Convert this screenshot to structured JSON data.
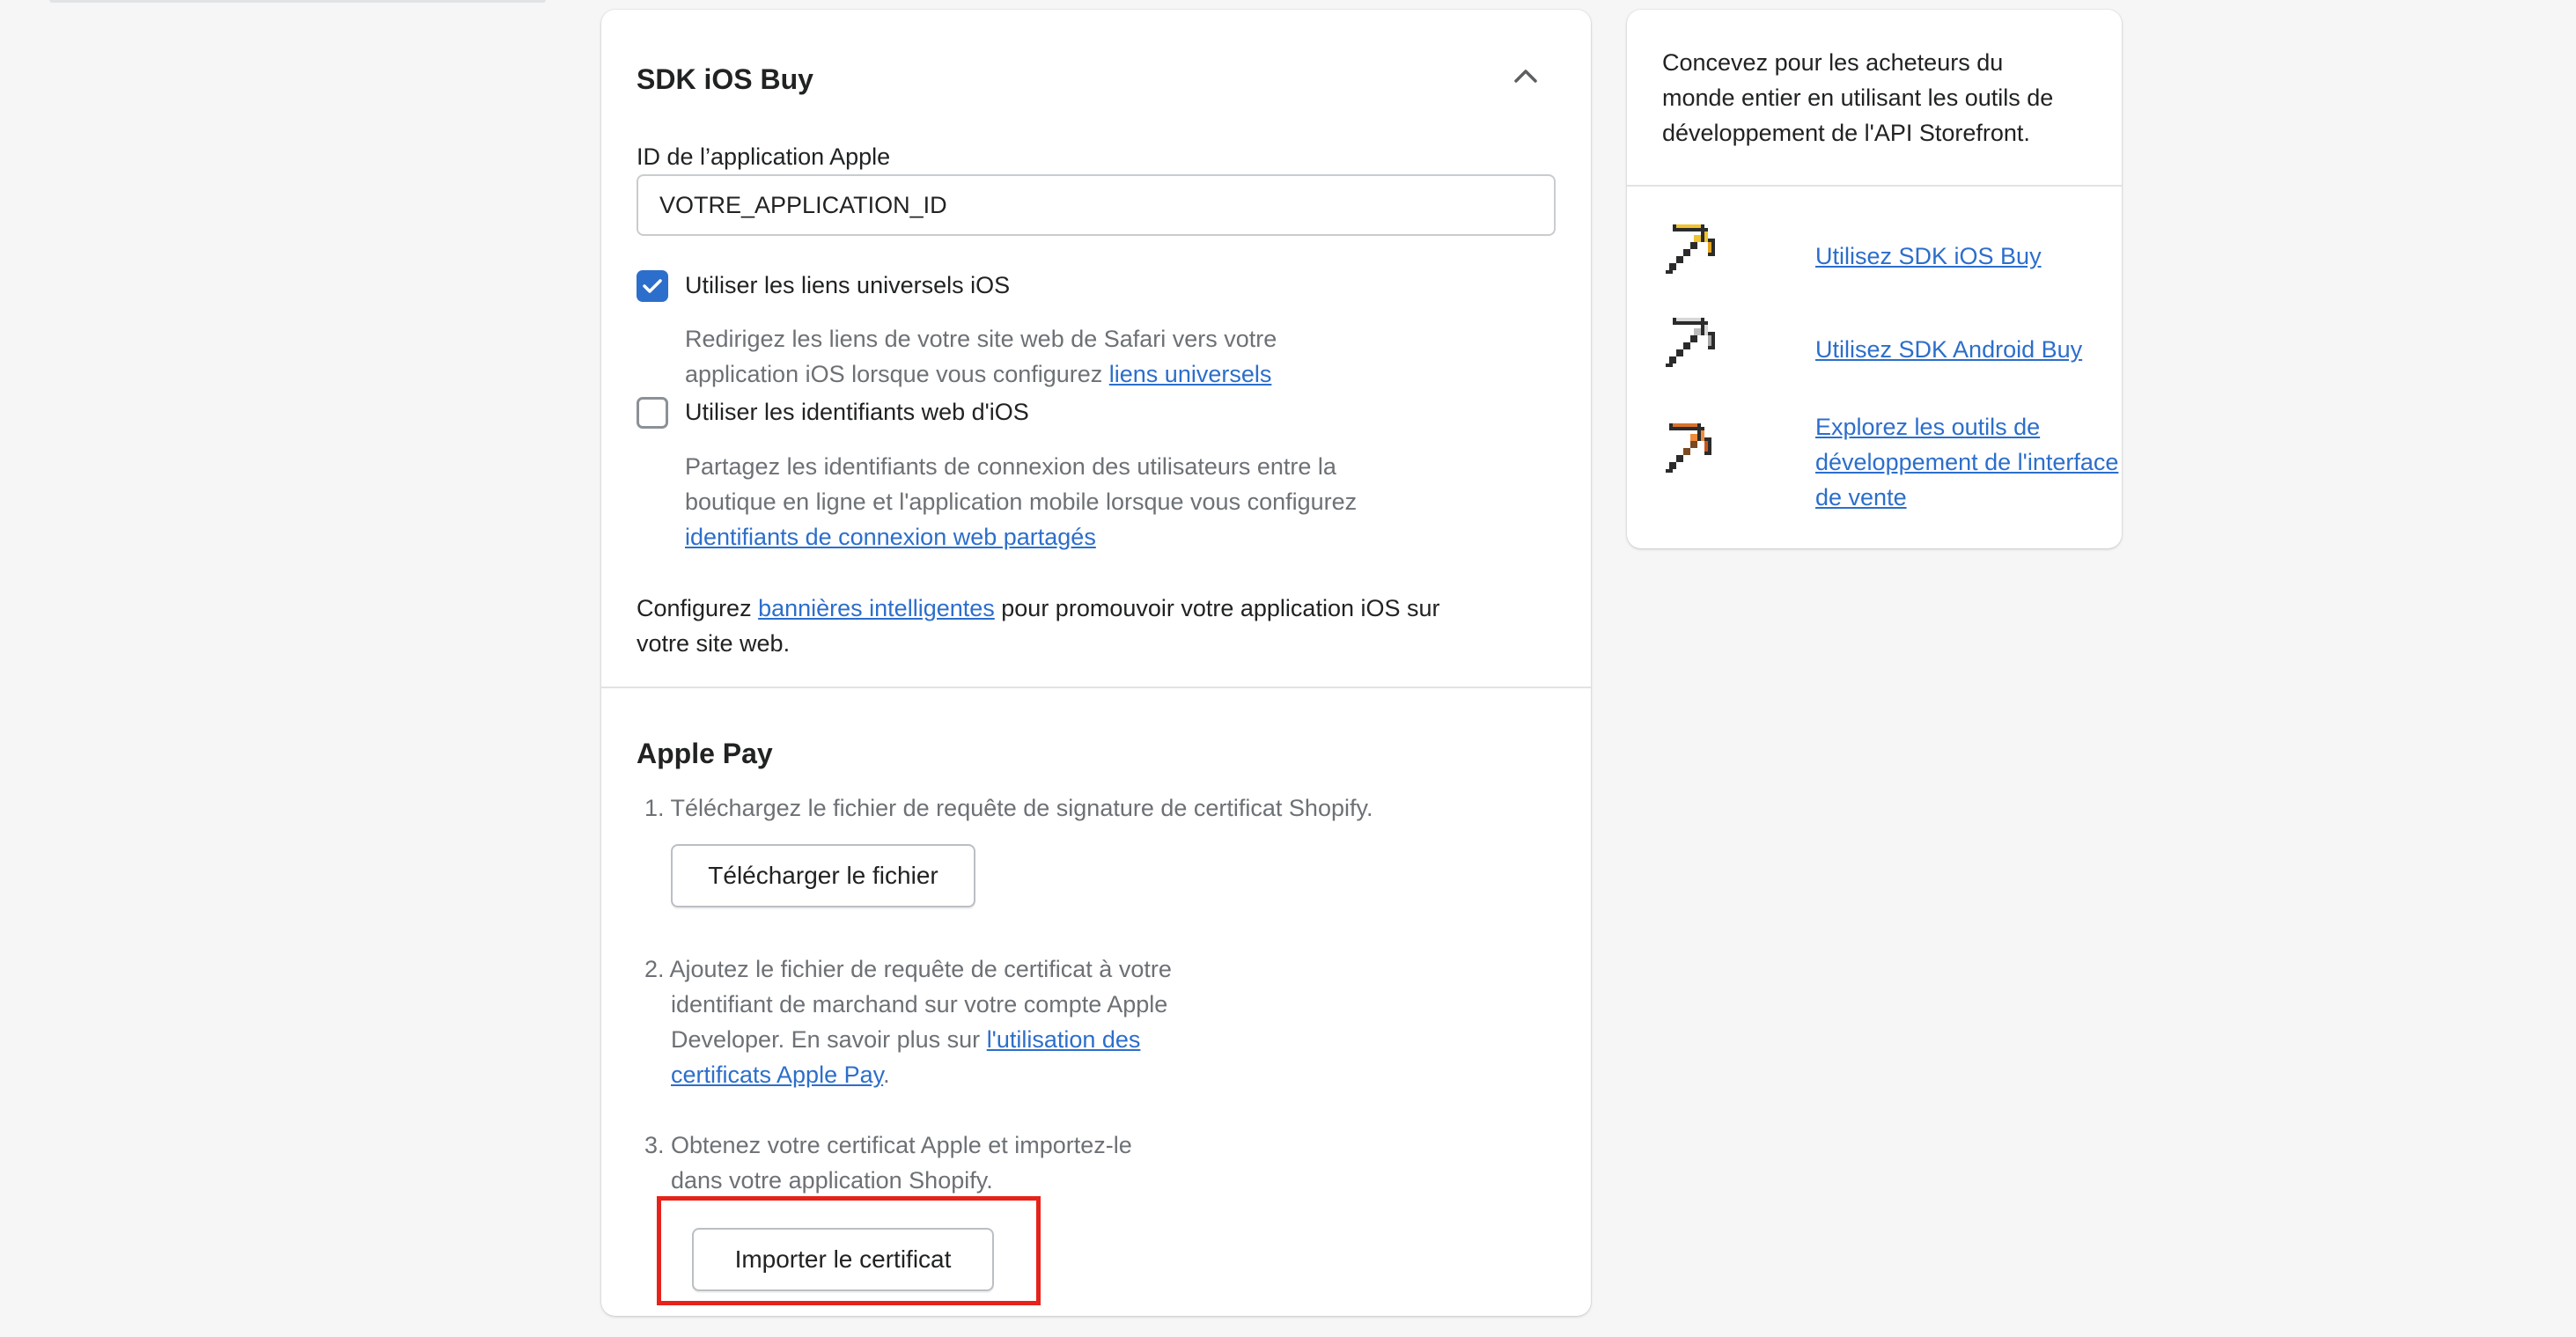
{
  "sdk_section": {
    "title": "SDK iOS Buy",
    "app_id_label": "ID de l’application Apple",
    "app_id_value": "VOTRE_APPLICATION_ID",
    "universal_links": {
      "label": "Utiliser les liens universels iOS",
      "checked": true,
      "desc_line1": "Redirigez les liens de votre site web de Safari vers votre",
      "desc_line2_prefix": "application iOS lorsque vous configurez ",
      "desc_link": "liens universels"
    },
    "web_credentials": {
      "label": "Utiliser les identifiants web d'iOS",
      "checked": false,
      "desc_line1": "Partagez les identifiants de connexion des utilisateurs entre la",
      "desc_line2": "boutique en ligne et l'application mobile lorsque vous configurez",
      "desc_link": "identifiants de connexion web partagés"
    },
    "banner": {
      "prefix": "Configurez ",
      "link": "bannières intelligentes",
      "suffix": " pour promouvoir votre application iOS sur",
      "line2": "votre site web."
    }
  },
  "apple_pay": {
    "title": "Apple Pay",
    "step1": "1. Téléchargez le fichier de requête de signature de certificat Shopify.",
    "download_button": "Télécharger le fichier",
    "step2_line1": "2. Ajoutez le fichier de requête de certificat à votre",
    "step2_line2": "identifiant de marchand sur votre compte Apple",
    "step2_line3_prefix": "Developer. En savoir plus sur ",
    "step2_link_part1": "l'utilisation des",
    "step2_link_part2": "certificats Apple Pay",
    "step2_end": ".",
    "step3_line1": "3. Obtenez votre certificat Apple et importez-le",
    "step3_line2": "dans votre application Shopify.",
    "import_button": "Importer le certificat"
  },
  "sidebar": {
    "intro_line1": "Concevez pour les acheteurs du",
    "intro_line2": "monde entier en utilisant les outils de",
    "intro_line3": "développement de l'API Storefront.",
    "links": [
      {
        "label": "Utilisez SDK iOS Buy",
        "icon": "pickaxe-gold-icon"
      },
      {
        "label": "Utilisez SDK Android Buy",
        "icon": "pickaxe-iron-icon"
      },
      {
        "label_line1": "Explorez les outils de",
        "label_line2": "développement de l'interface",
        "label_line3": "de vente",
        "icon": "pickaxe-copper-icon"
      }
    ]
  },
  "colors": {
    "accent": "#2c6ecb",
    "highlight": "#e5231b",
    "background": "#f6f6f7",
    "muted_text": "#6d7175"
  }
}
